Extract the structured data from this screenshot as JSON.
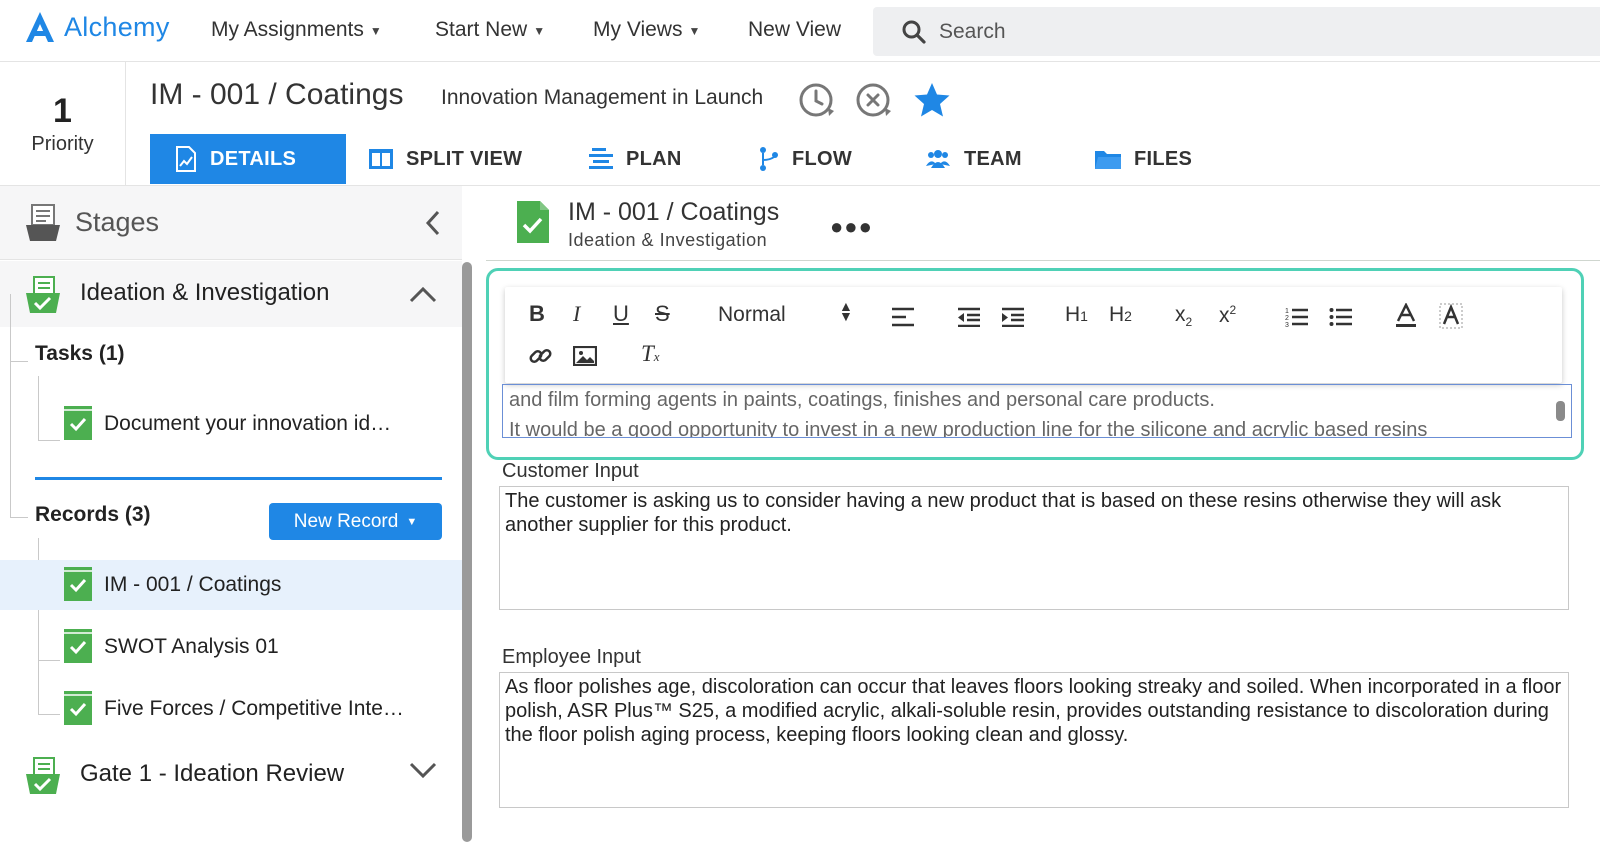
{
  "app": {
    "name": "Alchemy"
  },
  "nav": {
    "items": [
      {
        "label": "My Assignments",
        "has_dropdown": true
      },
      {
        "label": "Start New",
        "has_dropdown": true
      },
      {
        "label": "My Views",
        "has_dropdown": true
      },
      {
        "label": "New View",
        "has_dropdown": false
      }
    ],
    "search_placeholder": "Search"
  },
  "record": {
    "priority_value": "1",
    "priority_label": "Priority",
    "title": "IM - 001 / Coatings",
    "subtitle": "Innovation Management in Launch",
    "favorite_color": "#1f87e5"
  },
  "tabs": [
    {
      "label": "DETAILS",
      "icon": "details-icon",
      "active": true
    },
    {
      "label": "SPLIT VIEW",
      "icon": "split-view-icon",
      "active": false
    },
    {
      "label": "PLAN",
      "icon": "plan-icon",
      "active": false
    },
    {
      "label": "FLOW",
      "icon": "flow-icon",
      "active": false
    },
    {
      "label": "TEAM",
      "icon": "team-icon",
      "active": false
    },
    {
      "label": "FILES",
      "icon": "folder-icon",
      "active": false
    }
  ],
  "sidebar": {
    "title": "Stages",
    "stages": [
      {
        "label": "Ideation & Investigation",
        "expanded": true
      },
      {
        "label": "Gate 1 - Ideation Review",
        "expanded": false
      }
    ],
    "tasks_label": "Tasks (1)",
    "tasks": [
      {
        "label": "Document your innovation id…"
      }
    ],
    "records_label": "Records (3)",
    "new_record_label": "New Record",
    "records": [
      {
        "label": "IM - 001 / Coatings",
        "selected": true
      },
      {
        "label": "SWOT Analysis 01",
        "selected": false
      },
      {
        "label": "Five Forces / Competitive Inte…",
        "selected": false
      }
    ]
  },
  "main": {
    "title": "IM - 001 / Coatings",
    "subtitle": "Ideation & Investigation",
    "editor": {
      "format_select": "Normal",
      "line1": "and film forming agents in paints, coatings, finishes and personal care products.",
      "line2": "It would be a good opportunity to invest in a new production line for the silicone and acrylic based resins"
    },
    "customer_input_label": "Customer Input",
    "customer_input_value": "The customer is asking us to consider having a new product that is based on these resins otherwise they will ask another supplier for this product.",
    "employee_input_label": "Employee Input",
    "employee_input_value": "As floor polishes age, discoloration can occur that leaves floors looking streaky and soiled. When incorporated in a floor polish, ASR Plus™ S25, a modified acrylic, alkali-soluble resin, provides outstanding resistance to discoloration during the floor polish aging process, keeping floors looking clean and glossy."
  },
  "colors": {
    "brand_blue": "#1f87e5",
    "doc_green": "#4caf50",
    "editor_highlight": "#4fd1b6"
  }
}
